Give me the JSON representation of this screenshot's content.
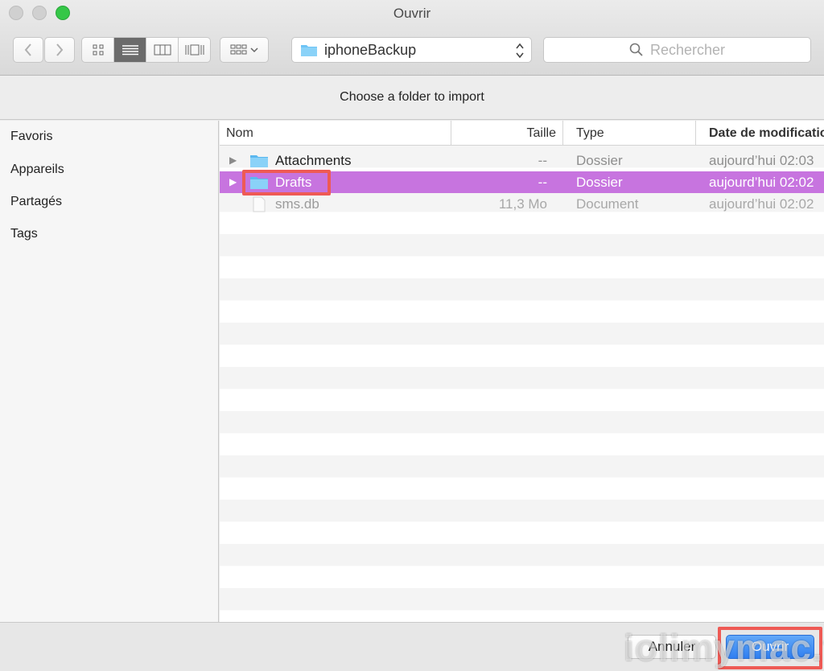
{
  "window": {
    "title": "Ouvrir"
  },
  "toolbar": {
    "path": "iphoneBackup",
    "search_placeholder": "Rechercher"
  },
  "message": "Choose a folder to import",
  "sidebar": {
    "items": [
      "Favoris",
      "Appareils",
      "Partagés",
      "Tags"
    ]
  },
  "columns": {
    "name": "Nom",
    "size": "Taille",
    "type": "Type",
    "date": "Date de modificatio"
  },
  "files": [
    {
      "name": "Attachments",
      "size": "--",
      "type": "Dossier",
      "date": "aujourd’hui 02:03",
      "kind": "folder"
    },
    {
      "name": "Drafts",
      "size": "--",
      "type": "Dossier",
      "date": "aujourd’hui 02:02",
      "kind": "folder",
      "selected": true
    },
    {
      "name": "sms.db",
      "size": "11,3 Mo",
      "type": "Document",
      "date": "aujourd’hui 02:02",
      "kind": "document"
    }
  ],
  "buttons": {
    "cancel": "Annuler",
    "open": "Ouvrir"
  },
  "watermark": "iolimymac.fr",
  "colors": {
    "selection": "#c774df",
    "highlight": "#ee5a55",
    "primary": "#2f7ff1",
    "folder": "#6ec4f5"
  }
}
